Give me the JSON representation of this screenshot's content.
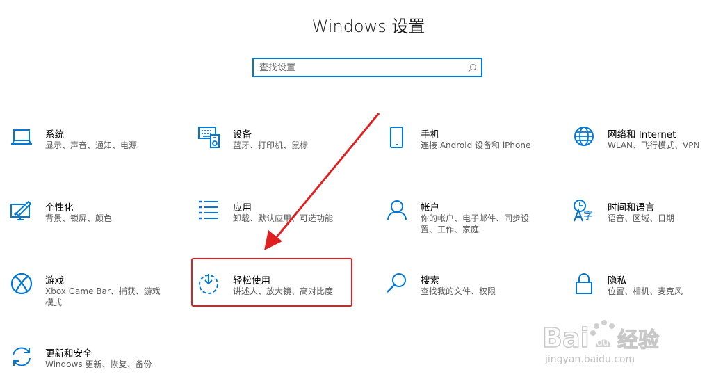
{
  "window": {
    "title": "Windows 设置"
  },
  "search": {
    "placeholder": "查找设置",
    "value": ""
  },
  "tiles": [
    {
      "name": "系统",
      "desc": "显示、声音、通知、电源",
      "icon": "laptop-icon"
    },
    {
      "name": "设备",
      "desc": "蓝牙、打印机、鼠标",
      "icon": "devices-icon"
    },
    {
      "name": "手机",
      "desc": "连接 Android 设备和 iPhone",
      "icon": "phone-icon"
    },
    {
      "name": "网络和 Internet",
      "desc": "WLAN、飞行模式、VPN",
      "icon": "globe-icon"
    },
    {
      "name": "个性化",
      "desc": "背景、锁屏、颜色",
      "icon": "personalization-icon"
    },
    {
      "name": "应用",
      "desc": "卸载、默认应用、可选功能",
      "icon": "apps-list-icon"
    },
    {
      "name": "帐户",
      "desc": "你的帐户、电子邮件、同步设置、工作、家庭",
      "desc_line1": "你的帐户、电子邮件、同步设",
      "desc_line2": "置、工作、家庭",
      "icon": "person-icon"
    },
    {
      "name": "时间和语言",
      "desc": "语音、区域、日期",
      "icon": "time-language-icon"
    },
    {
      "name": "游戏",
      "desc": "Xbox Game Bar、捕获、游戏模式",
      "desc_line1": "Xbox Game Bar、捕获、游戏",
      "desc_line2": "模式",
      "icon": "xbox-icon"
    },
    {
      "name": "轻松使用",
      "desc": "讲述人、放大镜、高对比度",
      "icon": "ease-of-access-icon"
    },
    {
      "name": "搜索",
      "desc": "查找我的文件、权限",
      "icon": "magnifier-icon"
    },
    {
      "name": "隐私",
      "desc": "位置、相机、麦克风",
      "icon": "lock-icon"
    },
    {
      "name": "更新和安全",
      "desc": "Windows 更新、恢复、备份",
      "icon": "sync-icon"
    }
  ],
  "watermark": {
    "text": "Bai du 经验",
    "url_text": "jingyan.baidu.com"
  },
  "colors": {
    "accent": "#0078d7",
    "annotation": "#e02020"
  }
}
